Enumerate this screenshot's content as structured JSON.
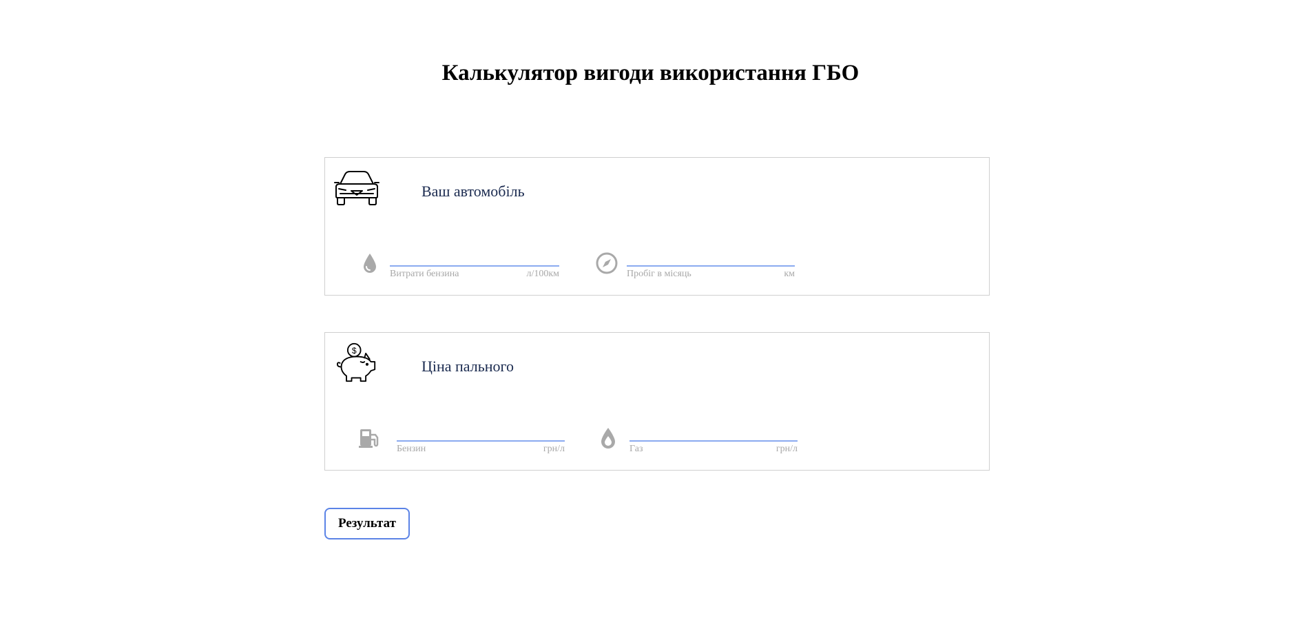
{
  "title": "Калькулятор вигоди використання ГБО",
  "car_section": {
    "title": "Ваш автомобіль",
    "icon": "car-icon",
    "fields": [
      {
        "icon": "drop-icon",
        "label": "Витрати бензина",
        "unit": "л/100км",
        "value": ""
      },
      {
        "icon": "compass-icon",
        "label": "Пробіг в місяць",
        "unit": "км",
        "value": ""
      }
    ]
  },
  "price_section": {
    "title": "Ціна пального",
    "icon": "piggy-bank-icon",
    "fields": [
      {
        "icon": "fuel-pump-icon",
        "label": "Бензин",
        "unit": "грн/л",
        "value": ""
      },
      {
        "icon": "gas-drop-icon",
        "label": "Газ",
        "unit": "грн/л",
        "value": ""
      }
    ]
  },
  "result_button": {
    "label": "Результат"
  },
  "colors": {
    "accent_blue": "#5b83e6",
    "input_underline": "#8aaaf0",
    "section_title": "#1a2a4f",
    "muted_text": "#a8a8a8",
    "card_border": "#cfcfcf"
  }
}
